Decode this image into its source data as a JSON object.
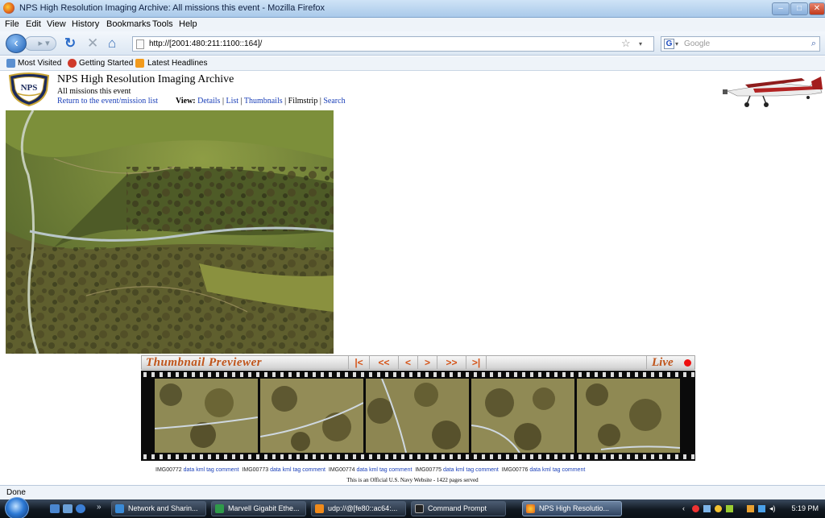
{
  "window": {
    "title": "NPS High Resolution Imaging Archive: All missions this event - Mozilla Firefox"
  },
  "menu": [
    "File",
    "Edit",
    "View",
    "History",
    "Bookmarks",
    "Tools",
    "Help"
  ],
  "nav": {
    "url": "http://[2001:480:211:1100::164]/",
    "search_placeholder": "Google"
  },
  "bookmarks": [
    "Most Visited",
    "Getting Started",
    "Latest Headlines"
  ],
  "page": {
    "title": "NPS High Resolution Imaging Archive",
    "subtitle": "All missions this event",
    "return_link": "Return to the event/mission list",
    "view_label": "View:",
    "views": [
      "Details",
      "List",
      "Thumbnails",
      "Filmstrip",
      "Search"
    ],
    "current_view": "Filmstrip",
    "seal_text": "NPS"
  },
  "previewer": {
    "title": "Thumbnail Previewer",
    "controls": [
      "|<",
      "<<",
      "<",
      ">",
      ">>",
      ">|"
    ],
    "live_label": "Live",
    "items": [
      {
        "id": "IMG00772",
        "links": [
          "data",
          "kml",
          "tag",
          "comment"
        ]
      },
      {
        "id": "IMG00773",
        "links": [
          "data",
          "kml",
          "tag",
          "comment"
        ]
      },
      {
        "id": "IMG00774",
        "links": [
          "data",
          "kml",
          "tag",
          "comment"
        ]
      },
      {
        "id": "IMG00775",
        "links": [
          "data",
          "kml",
          "tag",
          "comment"
        ]
      },
      {
        "id": "IMG00776",
        "links": [
          "data",
          "kml",
          "tag",
          "comment"
        ]
      }
    ]
  },
  "footer": {
    "note": "This is an Official U.S. Navy Website - 1422 pages served"
  },
  "status": {
    "text": "Done"
  },
  "taskbar": {
    "items": [
      "Network and Sharin...",
      "Marvell Gigabit Ethe...",
      "udp://@[fe80::ac64:...",
      "Command Prompt",
      "NPS High Resolutio..."
    ],
    "active_index": 4,
    "clock": "5:19 PM"
  }
}
